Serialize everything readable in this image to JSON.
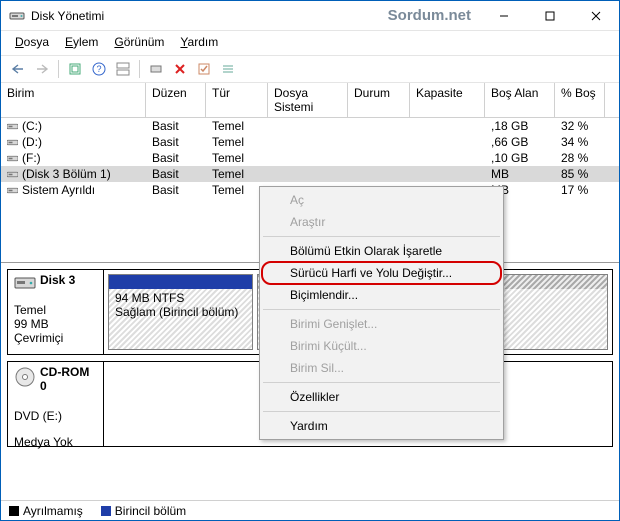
{
  "window": {
    "title": "Disk Yönetimi",
    "watermark": "Sordum.net"
  },
  "menu": {
    "file": "Dosya",
    "action": "Eylem",
    "view": "Görünüm",
    "help": "Yardım"
  },
  "columns": {
    "c0": "Birim",
    "c1": "Düzen",
    "c2": "Tür",
    "c3": "Dosya Sistemi",
    "c4": "Durum",
    "c5": "Kapasite",
    "c6": "Boş Alan",
    "c7": "% Boş"
  },
  "rows": [
    {
      "name": "(C:)",
      "layout": "Basit",
      "type": "Temel",
      "free": ",18 GB",
      "pct": "32 %"
    },
    {
      "name": "(D:)",
      "layout": "Basit",
      "type": "Temel",
      "free": ",66 GB",
      "pct": "34 %"
    },
    {
      "name": "(F:)",
      "layout": "Basit",
      "type": "Temel",
      "free": ",10 GB",
      "pct": "28 %"
    },
    {
      "name": "(Disk 3 Bölüm 1)",
      "layout": "Basit",
      "type": "Temel",
      "free": " MB",
      "pct": "85 %"
    },
    {
      "name": "Sistem Ayrıldı",
      "layout": "Basit",
      "type": "Temel",
      "free": " MB",
      "pct": "17 %"
    }
  ],
  "cm": {
    "open": "Aç",
    "explore": "Araştır",
    "markActive": "Bölümü Etkin Olarak İşaretle",
    "changeLetter": "Sürücü Harfi ve Yolu Değiştir...",
    "format": "Biçimlendir...",
    "extend": "Birimi Genişlet...",
    "shrink": "Birimi Küçült...",
    "delete": "Birim Sil...",
    "properties": "Özellikler",
    "help": "Yardım"
  },
  "disk3": {
    "title": "Disk 3",
    "type": "Temel",
    "size": "99 MB",
    "status": "Çevrimiçi",
    "part_label1": "94 MB NTFS",
    "part_label2": "Sağlam (Birincil bölüm)"
  },
  "cdrom": {
    "title": "CD-ROM 0",
    "sub": "DVD (E:)",
    "nomedia": "Medya Yok"
  },
  "legend": {
    "unalloc": "Ayrılmamış",
    "primary": "Birincil bölüm"
  }
}
